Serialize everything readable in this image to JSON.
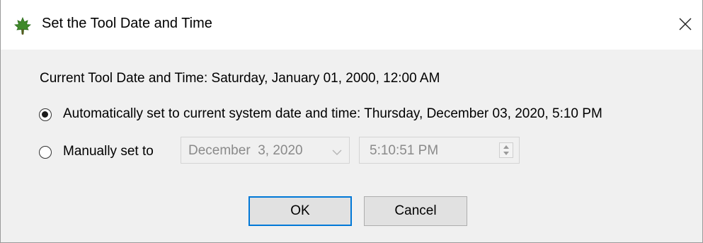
{
  "window": {
    "title": "Set the Tool Date and Time",
    "app_icon": "maple-leaf-icon",
    "close_icon": "close-icon"
  },
  "current": {
    "text": "Current Tool Date and Time: Saturday, January 01, 2000, 12:00 AM"
  },
  "options": {
    "auto": {
      "label": "Automatically set to current system date and time: Thursday, December 03, 2020, 5:10 PM",
      "selected": true
    },
    "manual": {
      "label": "Manually set to",
      "selected": false,
      "date_value": "December  3, 2020",
      "time_value": "5:10:51 PM"
    }
  },
  "buttons": {
    "ok": "OK",
    "cancel": "Cancel"
  },
  "colors": {
    "dialog_bg": "#f0f0f0",
    "titlebar_bg": "#ffffff",
    "focus_border": "#0078d7",
    "icon_green": "#3f8a2a"
  }
}
